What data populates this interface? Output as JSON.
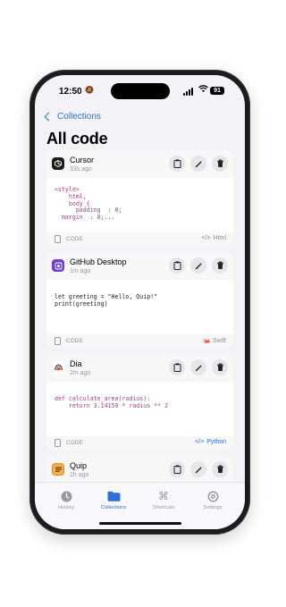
{
  "status_bar": {
    "time": "12:50",
    "battery": "91"
  },
  "nav": {
    "back_label": "Collections",
    "title": "All code"
  },
  "snippets": [
    {
      "app": "Cursor",
      "time": "33s ago",
      "icon": "cursor-icon",
      "code": "<style>\n    html,\n    body {\n      padding  : 0;\n  margin  : 0;...",
      "type_label": "CODE",
      "language": "Html",
      "lang_icon": "code-brackets-icon",
      "lang_color": "#8e8e93"
    },
    {
      "app": "GitHub Desktop",
      "time": "1m ago",
      "icon": "github-desktop-icon",
      "code": "let greeting = \"Hello, Quip!\"\nprint(greeting)",
      "type_label": "CODE",
      "language": "Swift",
      "lang_icon": "swift-icon",
      "lang_color": "#8e8e93"
    },
    {
      "app": "Dia",
      "time": "2m ago",
      "icon": "dia-icon",
      "code": "def calculate_area(radius):\n    return 3.14159 * radius ** 2",
      "type_label": "CODE",
      "language": "Python",
      "lang_icon": "code-brackets-icon",
      "lang_color": "#2f6fd6"
    },
    {
      "app": "Quip",
      "time": "1h ago",
      "icon": "quip-icon"
    }
  ],
  "tabs": [
    {
      "label": "History",
      "icon": "clock-icon",
      "active": false
    },
    {
      "label": "Collections",
      "icon": "folder-icon",
      "active": true
    },
    {
      "label": "Shortcuts",
      "icon": "command-icon",
      "active": false
    },
    {
      "label": "Settings",
      "icon": "gear-icon",
      "active": false
    }
  ],
  "colors": {
    "accent": "#2f6fd6",
    "background": "#f2f2f7",
    "code_keyword": "#b03a8e"
  }
}
